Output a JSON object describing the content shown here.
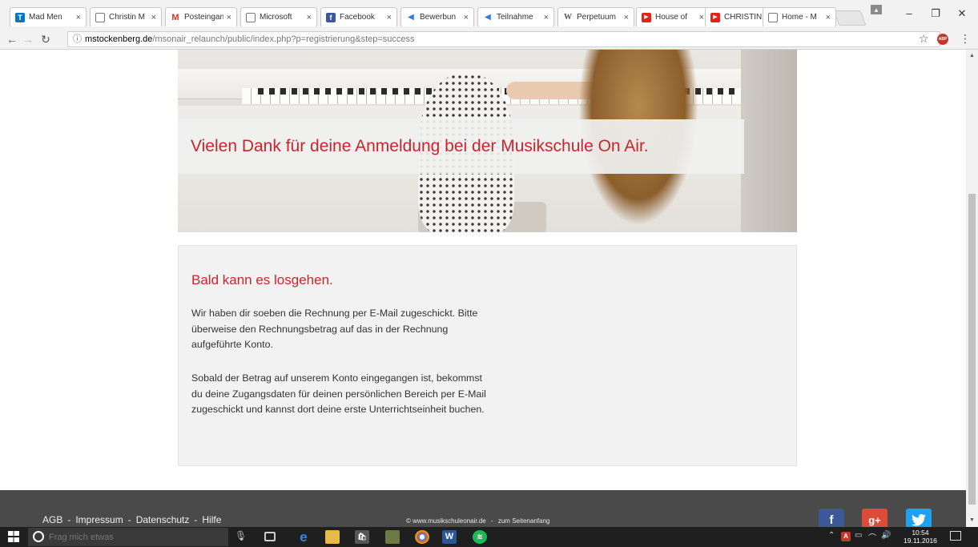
{
  "browser": {
    "tabs": [
      {
        "label": "Mad Men",
        "icon": "trello-icon",
        "color": "#0079bf"
      },
      {
        "label": "Christin M",
        "icon": "page-icon",
        "color": "#888888"
      },
      {
        "label": "Posteingan",
        "icon": "gmail-icon",
        "color": "#d93025"
      },
      {
        "label": "Microsoft",
        "icon": "page-icon",
        "color": "#888888"
      },
      {
        "label": "Facebook",
        "icon": "facebook-icon",
        "color": "#3b5998"
      },
      {
        "label": "Bewerbun",
        "icon": "feather-icon",
        "color": "#2c7be5"
      },
      {
        "label": "Teilnahme",
        "icon": "feather-icon",
        "color": "#2c7be5"
      },
      {
        "label": "Perpetuum",
        "icon": "wikipedia-icon",
        "color": "#555555"
      },
      {
        "label": "House of",
        "icon": "youtube-icon",
        "color": "#e62117"
      },
      {
        "label": "CHRISTIN",
        "icon": "youtube-icon",
        "color": "#e62117"
      },
      {
        "label": "Home - M",
        "icon": "page-icon",
        "color": "#888888",
        "active": true
      }
    ],
    "url_host": "mstockenberg.de",
    "url_path": "/msonair_relaunch/public/index.php?p=registrierung&step=success"
  },
  "page": {
    "hero_heading": "Vielen Dank für deine Anmeldung bei der Musikschule On Air.",
    "info_heading": "Bald kann es losgehen.",
    "paragraph1": "Wir haben dir soeben die Rechnung per E-Mail zugeschickt. Bitte überweise den Rechnungsbetrag auf das in der Rechnung aufgeführte Konto.",
    "paragraph2": "Sobald der Betrag auf unserem Konto eingegangen ist, bekommst du deine Zugangsdaten für deinen persönlichen Bereich per E-Mail zugeschickt und kannst dort deine erste Unterrichtseinheit buchen.",
    "accent_color": "#c8262a"
  },
  "footer": {
    "links": [
      "AGB",
      "Impressum",
      "Datenschutz",
      "Hilfe"
    ],
    "separator": "-",
    "copyright": "© www.musikschuleonair.de",
    "copy_separator": "-",
    "top_link": "zum Seitenanfang",
    "social": [
      "f",
      "g+"
    ]
  },
  "taskbar": {
    "search_placeholder": "Frag mich etwas",
    "time": "10:54",
    "date": "19.11.2016"
  }
}
